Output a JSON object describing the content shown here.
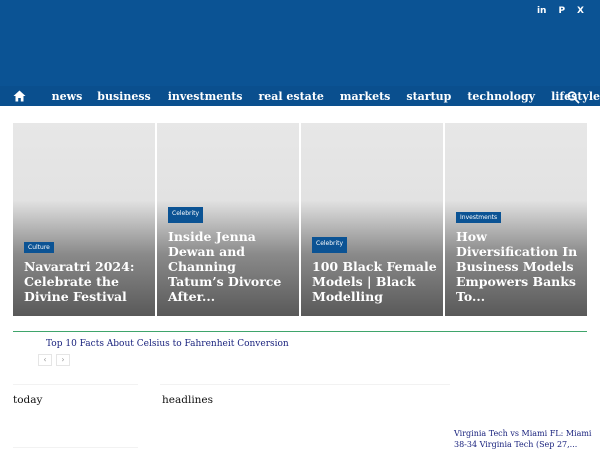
{
  "header": {
    "background_color": "#0b5394",
    "social": [
      {
        "icon": "linkedin-icon",
        "label": "in"
      },
      {
        "icon": "pinterest-icon",
        "label": "P"
      },
      {
        "icon": "x-icon",
        "label": "X"
      }
    ]
  },
  "nav": {
    "home_icon": "home-icon",
    "search_icon": "search-icon",
    "items": [
      "news",
      "business",
      "investments",
      "real estate",
      "markets",
      "startup",
      "technology",
      "lifestyle"
    ]
  },
  "featured": [
    {
      "category": "Culture",
      "title": "Navaratri 2024: Celebrate the Divine Festival"
    },
    {
      "category": "Celebrity",
      "title": "Inside Jenna Dewan and Channing Tatum’s Divorce After..."
    },
    {
      "category": "Celebrity",
      "title": "100 Black Female Models | Black Modelling"
    },
    {
      "category": "Investments",
      "title": "How Diversification In Business Models Empowers Banks To..."
    }
  ],
  "ticker": {
    "text": "Top 10 Facts About Celsius to Fahrenheit Conversion",
    "prev": "‹",
    "next": "›"
  },
  "sections": {
    "today": "today",
    "headlines": "headlines"
  },
  "sidebar_link": "Virginia Tech vs Miami FL: Miami 38-34 Virginia Tech (Sep 27,..."
}
